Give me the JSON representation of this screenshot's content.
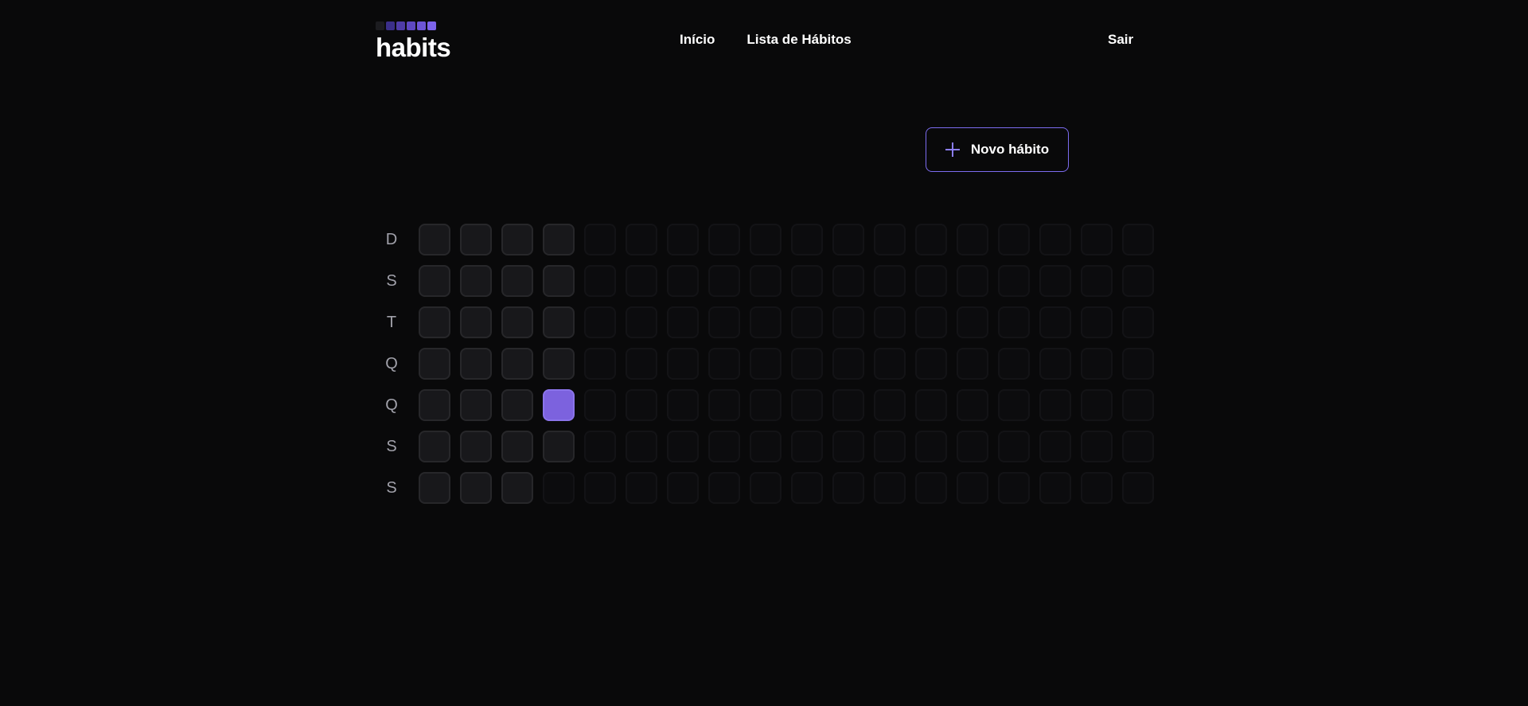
{
  "header": {
    "logo_text": "habits",
    "logo_squares": [
      "#1c1c20",
      "#3b2f8a",
      "#4f3ca8",
      "#5e48c2",
      "#6d55d6",
      "#7c63ea"
    ],
    "nav": [
      {
        "label": "Início"
      },
      {
        "label": "Lista de Hábitos"
      }
    ],
    "logout_label": "Sair"
  },
  "actions": {
    "new_habit_label": "Novo hábito"
  },
  "summary": {
    "weekdays": [
      "D",
      "S",
      "T",
      "Q",
      "Q",
      "S",
      "S"
    ],
    "columns": 18,
    "days_with_data": 27,
    "completion_levels": [
      0,
      0,
      0,
      0,
      0,
      0,
      0,
      0,
      0,
      0,
      0,
      0,
      0,
      0,
      0,
      0,
      0,
      0,
      0,
      0,
      0,
      0,
      0,
      0,
      0,
      1,
      0
    ]
  },
  "colors": {
    "background": "#09090a",
    "accent": "#7c62de",
    "button_border": "#7c6cf0",
    "day_bg": "#18181b",
    "day_border": "#27272a"
  }
}
